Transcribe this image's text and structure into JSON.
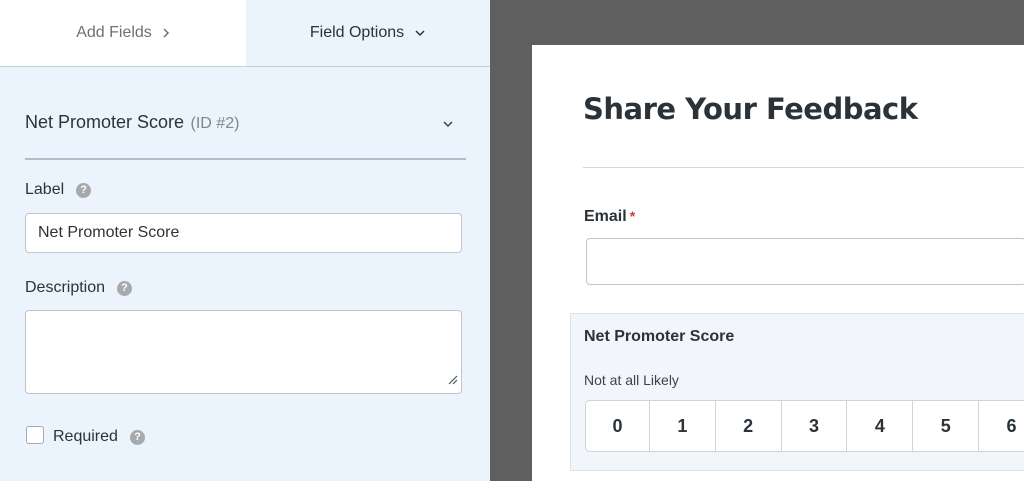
{
  "tabs": {
    "add_fields": "Add Fields",
    "field_options": "Field Options"
  },
  "field": {
    "name": "Net Promoter Score",
    "id_text": "(ID #2)"
  },
  "options": {
    "label_title": "Label",
    "label_value": "Net Promoter Score",
    "description_title": "Description",
    "description_value": "",
    "required_label": "Required",
    "required_checked": false,
    "help_glyph": "?"
  },
  "form": {
    "title": "Share Your Feedback",
    "email_label": "Email",
    "required_marker": "*",
    "nps_title": "Net Promoter Score",
    "nps_low_label": "Not at all Likely",
    "nps_scale": [
      "0",
      "1",
      "2",
      "3",
      "4",
      "5",
      "6"
    ]
  },
  "colors": {
    "panel_bg": "#ebf3fc",
    "canvas_bg": "#5f5f5f",
    "required_red": "#d63638"
  },
  "icons": {
    "tab_add": "chevron-right-icon",
    "tab_options": "chevron-down-icon",
    "collapse": "chevron-down-icon",
    "help": "help-icon",
    "resize": "resize-handle-icon"
  }
}
